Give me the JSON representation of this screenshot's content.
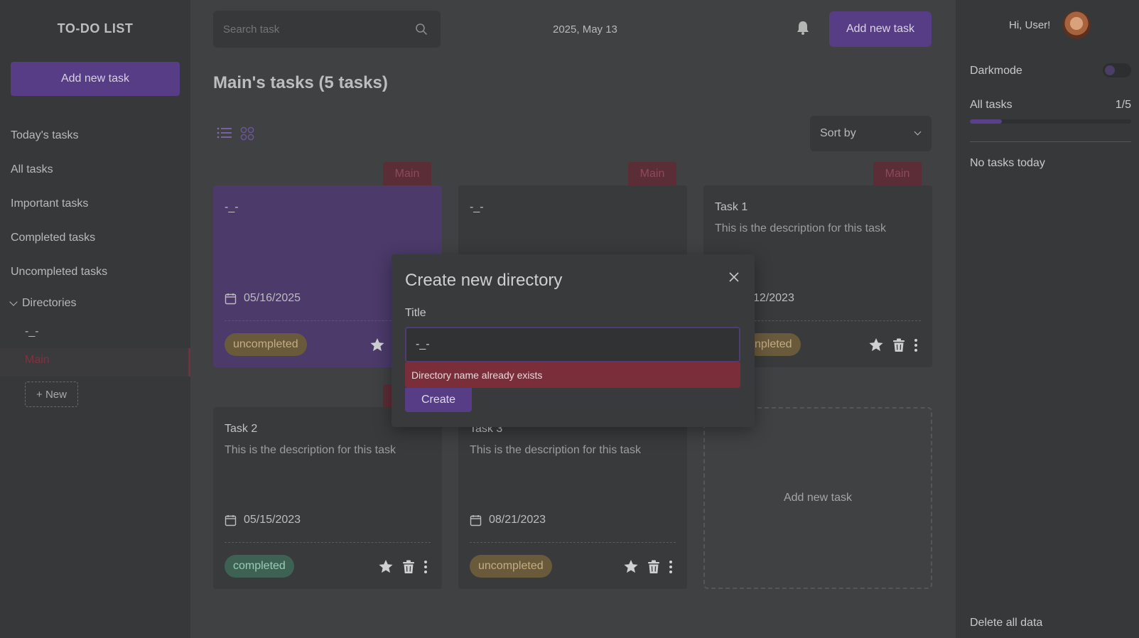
{
  "app": {
    "logo": "TO-DO LIST",
    "date": "2025, May 13",
    "page_title": "Main's tasks (5 tasks)"
  },
  "sidebar": {
    "add_button": "Add new task",
    "items": [
      {
        "label": "Today's tasks"
      },
      {
        "label": "All tasks"
      },
      {
        "label": "Important tasks"
      },
      {
        "label": "Completed tasks"
      },
      {
        "label": "Uncompleted tasks"
      }
    ],
    "directories_label": "Directories",
    "directories": [
      {
        "label": "-_-"
      },
      {
        "label": "Main"
      }
    ],
    "new_button": "+ New"
  },
  "topbar": {
    "search_placeholder": "Search task",
    "add_button": "Add new task",
    "sort_label": "Sort by"
  },
  "cards": [
    {
      "tag": "Main",
      "title": "-_-",
      "description": "",
      "date": "05/16/2025",
      "status": "uncompleted",
      "highlight": true
    },
    {
      "tag": "Main",
      "title": "-_-",
      "description": "",
      "date": "",
      "status": ""
    },
    {
      "tag": "Main",
      "title": "Task 1",
      "description": "This is the description for this task",
      "date": "12/2023",
      "status": "npleted"
    },
    {
      "tag": "",
      "title": "Task 2",
      "description": "This is the description for this task",
      "date": "05/15/2023",
      "status": "completed"
    },
    {
      "tag": "",
      "title": "Task 3",
      "description": "This is the description for this task",
      "date": "08/21/2023",
      "status": "uncompleted"
    }
  ],
  "add_card_label": "Add new task",
  "right_panel": {
    "greeting": "Hi, User!",
    "darkmode_label": "Darkmode",
    "all_tasks_label": "All tasks",
    "all_tasks_count": "1/5",
    "progress_fraction": 0.2,
    "no_tasks": "No tasks today",
    "delete_all": "Delete all data"
  },
  "modal": {
    "title": "Create new directory",
    "field_label": "Title",
    "input_value": "-_-",
    "error": "Directory name already exists",
    "create_button": "Create"
  },
  "colors": {
    "accent": "#573c86",
    "tag": "#5b2d36",
    "error": "#7a2e3a",
    "completed": "#3d6254",
    "uncompleted": "#6a5a3c"
  }
}
